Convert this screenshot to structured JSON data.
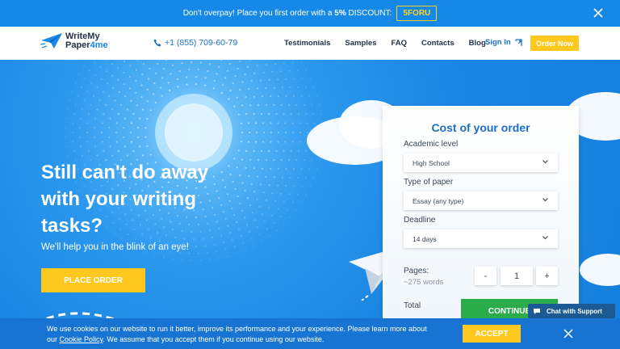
{
  "promo": {
    "text_prefix": "Don't overpay! Place you first order with a ",
    "discount": "5%",
    "text_suffix": " DISCOUNT:",
    "code": "5FORU"
  },
  "header": {
    "logo_line1": "WriteMy",
    "logo_line2a": "Paper",
    "logo_line2b": "4me",
    "phone": "+1 (855) 709-60-79",
    "nav": [
      "Testimonials",
      "Samples",
      "FAQ",
      "Contacts",
      "Blog"
    ],
    "signin": "Sign In",
    "order_now": "Order Now"
  },
  "hero": {
    "headline_1": "Still can't do away",
    "headline_2": "with your writing",
    "headline_3": "tasks?",
    "sub": "We'll help you in the blink of an eye!",
    "place_order": "PLACE ORDER"
  },
  "calculator": {
    "title": "Cost of your order",
    "academic_label": "Academic level",
    "academic_value": "High School",
    "paper_label": "Type of paper",
    "paper_value": "Essay (any type)",
    "deadline_label": "Deadline",
    "deadline_value": "14 days",
    "pages_label": "Pages:",
    "words": "~275 words",
    "minus": "-",
    "pages_value": "1",
    "plus": "+",
    "total_label": "Total",
    "continue": "CONTINUE"
  },
  "chat": {
    "label": "Chat with Support"
  },
  "cookie": {
    "msg_1": "We use cookies on our website to run it better, improve its performance and your experience. Please learn more about our ",
    "policy": "Cookie Policy",
    "msg_2": ". We assume that you accept them if you continue using our website.",
    "accept": "ACCEPT"
  },
  "colors": {
    "accent_yellow": "#ffc81e",
    "brand_blue": "#1689e8",
    "continue_green": "#2bac4a"
  }
}
